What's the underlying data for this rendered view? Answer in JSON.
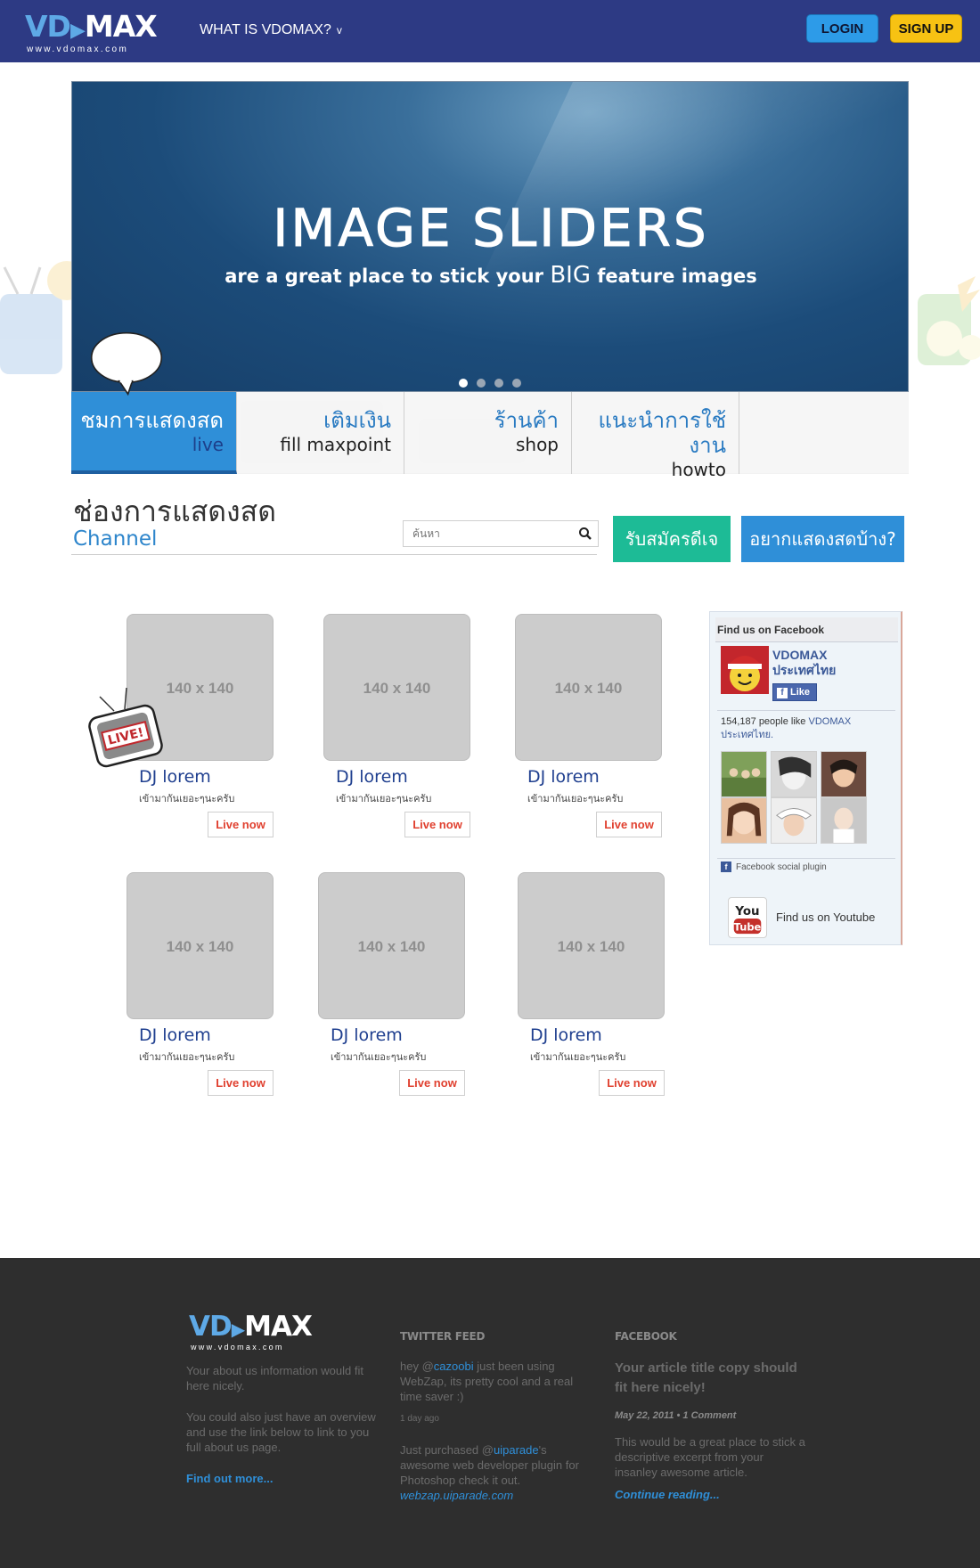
{
  "header": {
    "logo_main": "VD",
    "logo_main_rest": "MAX",
    "logo_url": "www.vdomax.com",
    "nav_label": "WHAT IS VDOMAX?",
    "nav_chevron": "v",
    "login_label": "LOGIN",
    "signup_label": "SIGN UP",
    "colors": {
      "bar": "#2d3a84",
      "login": "#2d9be8",
      "signup": "#f7c213"
    }
  },
  "slider": {
    "title": "IMAGE SLIDERS",
    "subtitle_a": "are a great place to stick your",
    "subtitle_big": "BIG",
    "subtitle_b": "feature images",
    "dots_total": 4,
    "active_dot": 1
  },
  "tabs": [
    {
      "th": "ชมการแสดงสด",
      "en": "live",
      "active": true
    },
    {
      "th": "เติมเงิน",
      "en": "fill maxpoint",
      "active": false
    },
    {
      "th": "ร้านค้า",
      "en": "shop",
      "active": false
    },
    {
      "th": "แนะนำการใช้งาน",
      "en": "howto",
      "active": false
    }
  ],
  "channel": {
    "title_th": "ช่องการแสดงสด",
    "title_en": "Channel",
    "search_placeholder": "ค้นหา",
    "btn_register": "รับสมัครดีเจ",
    "btn_perform": "อยากแสดงสดบ้าง?"
  },
  "cards": [
    {
      "thumb": "140 x 140",
      "name": "DJ lorem",
      "desc": "เข้ามากันเยอะๆนะครับ",
      "live": "Live now"
    },
    {
      "thumb": "140 x 140",
      "name": "DJ lorem",
      "desc": "เข้ามากันเยอะๆนะครับ",
      "live": "Live now"
    },
    {
      "thumb": "140 x 140",
      "name": "DJ lorem",
      "desc": "เข้ามากันเยอะๆนะครับ",
      "live": "Live now"
    },
    {
      "thumb": "140 x 140",
      "name": "DJ lorem",
      "desc": "เข้ามากันเยอะๆนะครับ",
      "live": "Live now"
    },
    {
      "thumb": "140 x 140",
      "name": "DJ lorem",
      "desc": "เข้ามากันเยอะๆนะครับ",
      "live": "Live now"
    },
    {
      "thumb": "140 x 140",
      "name": "DJ lorem",
      "desc": "เข้ามากันเยอะๆนะครับ",
      "live": "Live now"
    }
  ],
  "live_badge": "LIVE!",
  "facebook": {
    "heading": "Find us on Facebook",
    "page_name_1": "VDOMAX",
    "page_name_2": "ประเทศไทย",
    "like_label": "Like",
    "count_text": "154,187 people like",
    "count_link": "VDOMAX ประเทศไทย.",
    "plugin_label": "Facebook social plugin",
    "youtube_label": "Find us on Youtube"
  },
  "footer": {
    "about_1": "Your about us information would fit here nicely.",
    "about_2": "You could also just have an overview and use the link below to link to you full about us page.",
    "about_link": "Find out more...",
    "twitter_heading": "TWITTER FEED",
    "tw1_pre": "hey @",
    "tw1_handle": "cazoobi",
    "tw1_post": " just been using WebZap, its pretty cool and a real time saver :)",
    "tw1_time": "1 day ago",
    "tw2_pre": "Just purchased @",
    "tw2_handle": "uiparade",
    "tw2_post": "'s awesome web developer plugin for Photoshop check it out.",
    "tw2_link": "webzap.uiparade.com",
    "fb_heading": "FACEBOOK",
    "fb_title": "Your article title copy should fit here nicely!",
    "fb_meta": "May 22, 2011 • 1 Comment",
    "fb_excerpt": "This would be a great place to stick a descriptive excerpt from your insanley awesome article.",
    "fb_link": "Continue reading..."
  }
}
